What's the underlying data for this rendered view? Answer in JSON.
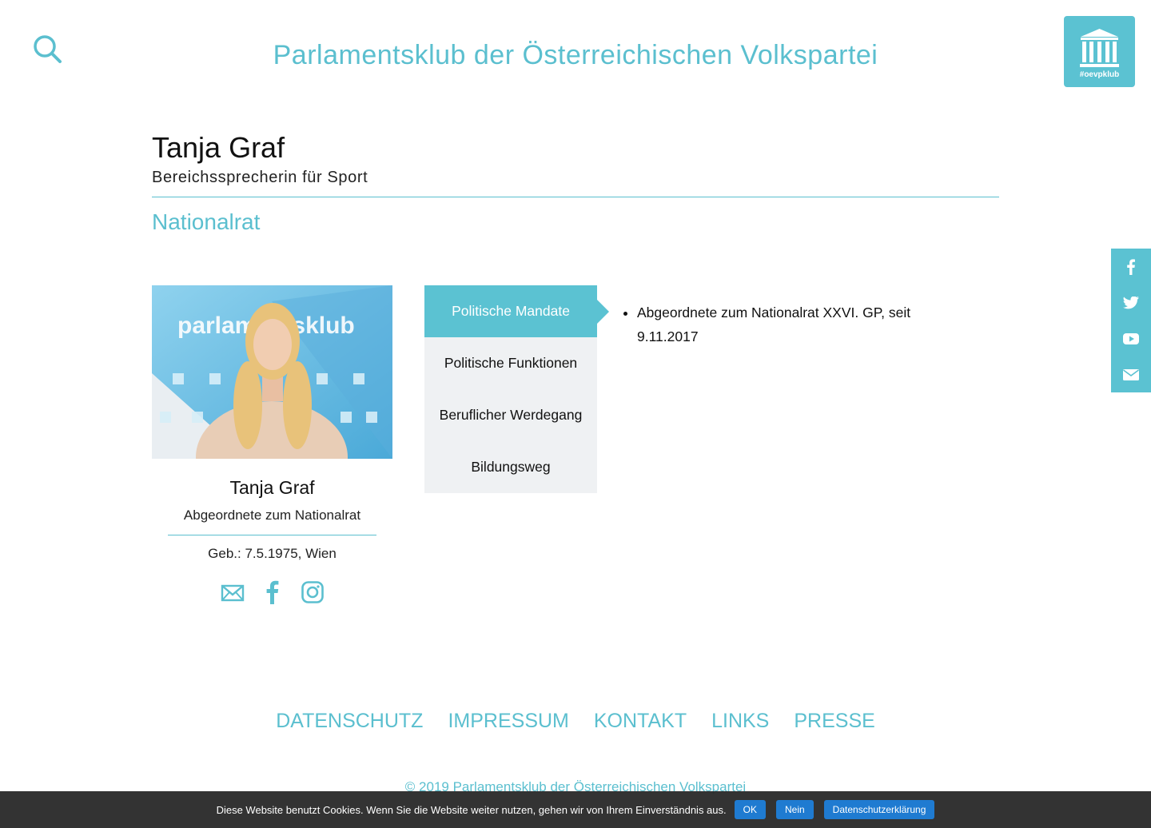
{
  "header": {
    "site_title": "Parlamentsklub der Österreichischen Volkspartei",
    "logo_tag": "#oevpklub"
  },
  "profile": {
    "name": "Tanja Graf",
    "role": "Bereichssprecherin für Sport",
    "chamber": "Nationalrat",
    "photo_text": "parlamentsklub"
  },
  "card": {
    "name": "Tanja Graf",
    "role": "Abgeordnete zum Nationalrat",
    "birth": "Geb.: 7.5.1975, Wien"
  },
  "tabs": [
    {
      "label": "Politische Mandate",
      "active": true
    },
    {
      "label": "Politische Funktionen",
      "active": false
    },
    {
      "label": "Beruflicher Werdegang",
      "active": false
    },
    {
      "label": "Bildungsweg",
      "active": false
    }
  ],
  "mandates": [
    "Abgeordnete zum Nationalrat XXVI. GP, seit 9.11.2017"
  ],
  "footer": {
    "links": [
      "DATENSCHUTZ",
      "IMPRESSUM",
      "KONTAKT",
      "LINKS",
      "PRESSE"
    ],
    "copyright": "© 2019 Parlamentsklub der Österreichischen Volkspartei"
  },
  "cookie": {
    "text": "Diese Website benutzt Cookies. Wenn Sie die Website weiter nutzen, gehen wir von Ihrem Einverständnis aus.",
    "ok": "OK",
    "no": "Nein",
    "privacy": "Datenschutzerklärung"
  },
  "colors": {
    "accent": "#5bc2d2",
    "tab_bg": "#eff1f3",
    "cookie_btn": "#1f7bd1"
  },
  "icons": {
    "search": "search-icon",
    "logo": "parliament-icon",
    "card_social": [
      "mail-icon",
      "facebook-icon",
      "instagram-icon"
    ],
    "side_social": [
      "facebook-icon",
      "twitter-icon",
      "youtube-icon",
      "mail-icon"
    ]
  }
}
